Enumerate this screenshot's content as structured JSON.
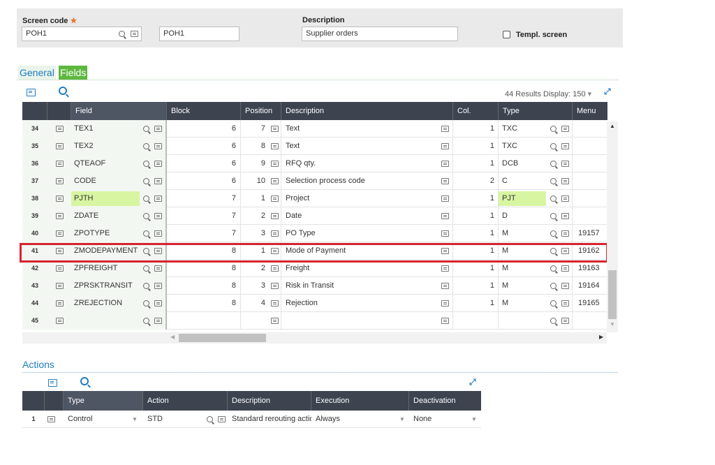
{
  "header": {
    "screen_code_label": "Screen code",
    "required_mark": "★",
    "screen_code_value": "POH1",
    "screen_code_copy": "POH1",
    "description_label": "Description",
    "description_value": "Supplier orders",
    "templ_label": "Templ. screen"
  },
  "tabs": [
    {
      "label": "General"
    },
    {
      "label": "Fields"
    }
  ],
  "fields_toolbar": {
    "results": "44 Results",
    "display_label": "Display:",
    "display_value": "150"
  },
  "columns": {
    "field": "Field",
    "block": "Block",
    "position": "Position",
    "description": "Description",
    "col": "Col.",
    "type": "Type",
    "menu": "Menu"
  },
  "rows": [
    {
      "n": "34",
      "field": "TEX1",
      "block": "6",
      "pos": "7",
      "desc": "Text",
      "col": "1",
      "type": "TXC",
      "menu": ""
    },
    {
      "n": "35",
      "field": "TEX2",
      "block": "6",
      "pos": "8",
      "desc": "Text",
      "col": "1",
      "type": "TXC",
      "menu": ""
    },
    {
      "n": "36",
      "field": "QTEAOF",
      "block": "6",
      "pos": "9",
      "desc": "RFQ qty.",
      "col": "1",
      "type": "DCB",
      "menu": ""
    },
    {
      "n": "37",
      "field": "CODE",
      "block": "6",
      "pos": "10",
      "desc": "Selection process code",
      "col": "2",
      "type": "C",
      "menu": ""
    },
    {
      "n": "38",
      "field": "PJTH",
      "block": "7",
      "pos": "1",
      "desc": "Project",
      "col": "1",
      "type": "PJT",
      "menu": ""
    },
    {
      "n": "39",
      "field": "ZDATE",
      "block": "7",
      "pos": "2",
      "desc": "Date",
      "col": "1",
      "type": "D",
      "menu": ""
    },
    {
      "n": "40",
      "field": "ZPOTYPE",
      "block": "7",
      "pos": "3",
      "desc": "PO Type",
      "col": "1",
      "type": "M",
      "menu": "19157"
    },
    {
      "n": "41",
      "field": "ZMODEPAYMENT",
      "block": "8",
      "pos": "1",
      "desc": "Mode of Payment",
      "col": "1",
      "type": "M",
      "menu": "19162"
    },
    {
      "n": "42",
      "field": "ZPFREIGHT",
      "block": "8",
      "pos": "2",
      "desc": "Freight",
      "col": "1",
      "type": "M",
      "menu": "19163"
    },
    {
      "n": "43",
      "field": "ZPRSKTRANSIT",
      "block": "8",
      "pos": "3",
      "desc": "Risk in Transit",
      "col": "1",
      "type": "M",
      "menu": "19164"
    },
    {
      "n": "44",
      "field": "ZREJECTION",
      "block": "8",
      "pos": "4",
      "desc": "Rejection",
      "col": "1",
      "type": "M",
      "menu": "19165"
    },
    {
      "n": "45",
      "field": "",
      "block": "",
      "pos": "",
      "desc": "",
      "col": "",
      "type": "",
      "menu": ""
    }
  ],
  "actions": {
    "title": "Actions",
    "columns": {
      "type": "Type",
      "action": "Action",
      "description": "Description",
      "execution": "Execution",
      "deactivation": "Deactivation"
    },
    "rows": [
      {
        "n": "1",
        "type": "Control",
        "action": "STD",
        "description": "Standard rerouting actio",
        "execution": "Always",
        "deactivation": "None"
      }
    ]
  }
}
